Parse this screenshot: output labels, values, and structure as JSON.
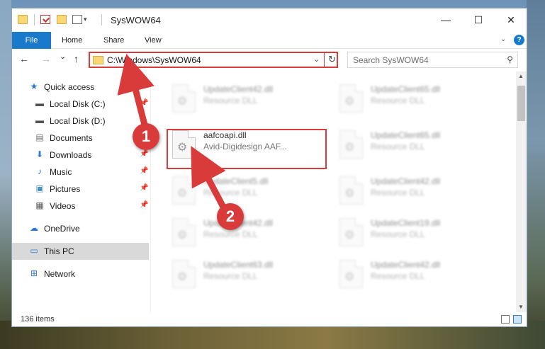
{
  "window": {
    "title": "SysWOW64",
    "minimize": "—",
    "maximize": "☐",
    "close": "✕"
  },
  "ribbon": {
    "tabs": [
      "File",
      "Home",
      "Share",
      "View"
    ],
    "expand_icon": "chevron-down-icon",
    "help_label": "?"
  },
  "nav": {
    "back": "←",
    "forward": "→",
    "recent": "⌄",
    "up": "↑",
    "address": "C:\\Windows\\SysWOW64",
    "address_dropdown": "⌄",
    "refresh": "↻",
    "search_placeholder": "Search SysWOW64",
    "search_icon": "⚲"
  },
  "sidebar": {
    "items": [
      {
        "label": "Quick access",
        "icon": "star-icon",
        "pinned": false
      },
      {
        "label": "Local Disk (C:)",
        "icon": "drive-icon",
        "pinned": true
      },
      {
        "label": "Local Disk (D:)",
        "icon": "drive-icon",
        "pinned": false
      },
      {
        "label": "Documents",
        "icon": "documents-icon",
        "pinned": true
      },
      {
        "label": "Downloads",
        "icon": "download-icon",
        "pinned": true
      },
      {
        "label": "Music",
        "icon": "music-icon",
        "pinned": true
      },
      {
        "label": "Pictures",
        "icon": "pictures-icon",
        "pinned": true
      },
      {
        "label": "Videos",
        "icon": "videos-icon",
        "pinned": true
      },
      {
        "label": "OneDrive",
        "icon": "cloud-icon",
        "pinned": false
      },
      {
        "label": "This PC",
        "icon": "computer-icon",
        "pinned": false,
        "selected": true
      },
      {
        "label": "Network",
        "icon": "network-icon",
        "pinned": false
      }
    ]
  },
  "files": {
    "focused": {
      "name": "aafcoapi.dll",
      "type": "Avid-Digidesign AAF..."
    },
    "background": [
      {
        "name": "UpdateClient42.dll",
        "type": "Resource DLL"
      },
      {
        "name": "UpdateClient65.dll",
        "type": "Resource DLL"
      },
      {
        "name": "UpdateClient65.dll",
        "type": "Resource DLL"
      },
      {
        "name": "UpdateClient5.dll",
        "type": "Resource DLL"
      },
      {
        "name": "UpdateClient42.dll",
        "type": "Resource DLL"
      },
      {
        "name": "UpdateClient42.dll",
        "type": "Resource DLL"
      },
      {
        "name": "UpdateClient19.dll",
        "type": "Resource DLL"
      },
      {
        "name": "UpdateClient63.dll",
        "type": "Resource DLL"
      },
      {
        "name": "UpdateClient42.dll",
        "type": "Resource DLL"
      }
    ]
  },
  "status": {
    "item_count": "136 items"
  },
  "annotations": {
    "step1": "1",
    "step2": "2",
    "color": "#d93b3b"
  }
}
